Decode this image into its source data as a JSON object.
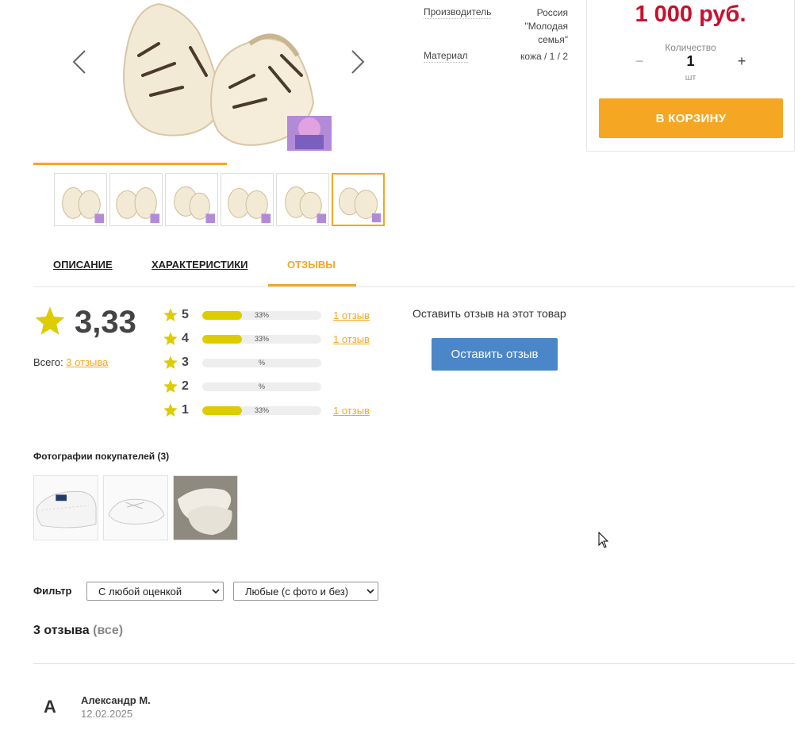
{
  "specs": {
    "manufacturer_label": "Производитель",
    "manufacturer_value_1": "Россия",
    "manufacturer_value_2": "\"Молодая",
    "manufacturer_value_3": "семья\"",
    "material_label": "Материал",
    "material_value": "кожа / 1 / 2"
  },
  "buybox": {
    "price": "1 000 руб.",
    "quantity_label": "Количество",
    "minus": "−",
    "quantity": "1",
    "plus": "+",
    "unit": "шт",
    "cart_button": "В КОРЗИНУ"
  },
  "tabs": [
    {
      "label": "ОПИСАНИЕ"
    },
    {
      "label": "ХАРАКТЕРИСТИКИ"
    },
    {
      "label": "ОТЗЫВЫ"
    }
  ],
  "rating": {
    "average": "3,33",
    "total_label": "Всего:",
    "total_link": "3 отзыва",
    "distribution": [
      {
        "stars": "5",
        "percent": 33,
        "bar_text": "33%",
        "count": "1 отзыв"
      },
      {
        "stars": "4",
        "percent": 33,
        "bar_text": "33%",
        "count": "1 отзыв"
      },
      {
        "stars": "3",
        "percent": 0,
        "bar_text": "%",
        "count": ""
      },
      {
        "stars": "2",
        "percent": 0,
        "bar_text": "%",
        "count": ""
      },
      {
        "stars": "1",
        "percent": 33,
        "bar_text": "33%",
        "count": "1 отзыв"
      }
    ],
    "leave_text": "Оставить отзыв на этот товар",
    "leave_button": "Оставить отзыв"
  },
  "customer_photos": {
    "title": "Фотографии покупателей (3)"
  },
  "filter": {
    "label": "Фильтр",
    "rating_selected": "С любой оценкой",
    "photo_selected": "Любые (с фото и без)"
  },
  "reviews": {
    "title": "3 отзыва",
    "all": "(все)",
    "items": [
      {
        "avatar": "А",
        "author": "Александр М.",
        "date": "12.02.2025"
      }
    ]
  },
  "colors": {
    "accent": "#f5a623",
    "price": "#c8102e",
    "star": "#ddcc00",
    "button_blue": "#4a86c8"
  }
}
